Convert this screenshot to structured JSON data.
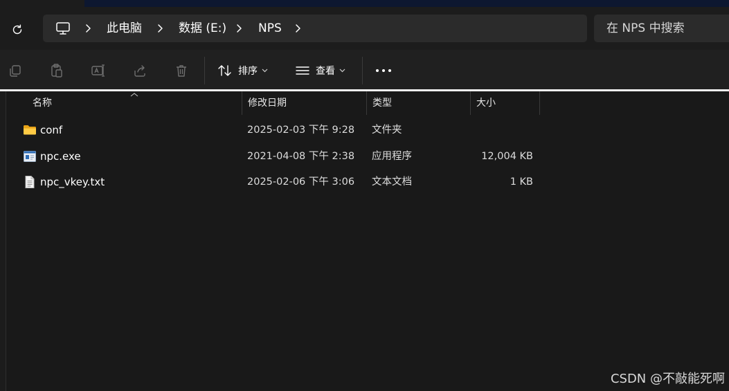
{
  "breadcrumb": {
    "items": [
      {
        "label": "此电脑"
      },
      {
        "label": "数据 (E:)"
      },
      {
        "label": "NPS"
      }
    ]
  },
  "search": {
    "placeholder": "在 NPS 中搜索"
  },
  "toolbar": {
    "sort_label": "排序",
    "view_label": "查看"
  },
  "columns": {
    "name": "名称",
    "modified": "修改日期",
    "type": "类型",
    "size": "大小"
  },
  "files": [
    {
      "name": "conf",
      "modified": "2025-02-03 下午 9:28",
      "type": "文件夹",
      "size": "",
      "icon": "folder-icon"
    },
    {
      "name": "npc.exe",
      "modified": "2021-04-08 下午 2:38",
      "type": "应用程序",
      "size": "12,004 KB",
      "icon": "exe-icon"
    },
    {
      "name": "npc_vkey.txt",
      "modified": "2025-02-06 下午 3:06",
      "type": "文本文档",
      "size": "1 KB",
      "icon": "text-file-icon"
    }
  ],
  "watermark": "CSDN @不敲能死啊",
  "colors": {
    "accent": "#ffcb45",
    "background": "#191919",
    "toolbar": "#202020"
  }
}
